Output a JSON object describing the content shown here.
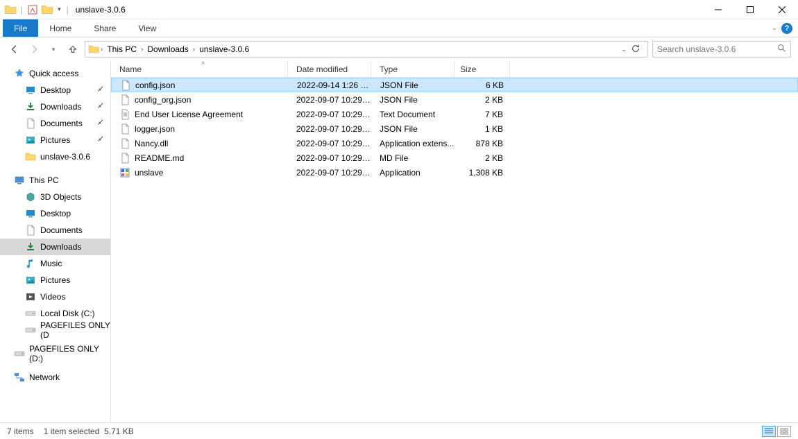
{
  "title": "unslave-3.0.6",
  "ribbon": {
    "file": "File",
    "home": "Home",
    "share": "Share",
    "view": "View"
  },
  "breadcrumbs": [
    "This PC",
    "Downloads",
    "unslave-3.0.6"
  ],
  "search_placeholder": "Search unslave-3.0.6",
  "columns": {
    "name": "Name",
    "date": "Date modified",
    "type": "Type",
    "size": "Size"
  },
  "sidebar": {
    "quick_access": "Quick access",
    "qa_items": [
      {
        "label": "Desktop",
        "icon": "desktop",
        "pinned": true
      },
      {
        "label": "Downloads",
        "icon": "downloads",
        "pinned": true
      },
      {
        "label": "Documents",
        "icon": "documents",
        "pinned": true
      },
      {
        "label": "Pictures",
        "icon": "pictures",
        "pinned": true
      },
      {
        "label": "unslave-3.0.6",
        "icon": "folder",
        "pinned": false
      }
    ],
    "this_pc": "This PC",
    "pc_items": [
      {
        "label": "3D Objects",
        "icon": "3d"
      },
      {
        "label": "Desktop",
        "icon": "desktop"
      },
      {
        "label": "Documents",
        "icon": "documents"
      },
      {
        "label": "Downloads",
        "icon": "downloads",
        "selected": true
      },
      {
        "label": "Music",
        "icon": "music"
      },
      {
        "label": "Pictures",
        "icon": "pictures"
      },
      {
        "label": "Videos",
        "icon": "videos"
      },
      {
        "label": "Local Disk (C:)",
        "icon": "disk"
      },
      {
        "label": "PAGEFILES ONLY (D",
        "icon": "disk"
      }
    ],
    "extra_drive": "PAGEFILES ONLY (D:)",
    "network": "Network"
  },
  "files": [
    {
      "name": "config.json",
      "date": "2022-09-14 1:26 PM",
      "type": "JSON File",
      "size": "6 KB",
      "icon": "file",
      "selected": true
    },
    {
      "name": "config_org.json",
      "date": "2022-09-07 10:29 ...",
      "type": "JSON File",
      "size": "2 KB",
      "icon": "file"
    },
    {
      "name": "End User License Agreement",
      "date": "2022-09-07 10:29 ...",
      "type": "Text Document",
      "size": "7 KB",
      "icon": "text"
    },
    {
      "name": "logger.json",
      "date": "2022-09-07 10:29 ...",
      "type": "JSON File",
      "size": "1 KB",
      "icon": "file"
    },
    {
      "name": "Nancy.dll",
      "date": "2022-09-07 10:29 ...",
      "type": "Application extens...",
      "size": "878 KB",
      "icon": "file"
    },
    {
      "name": "README.md",
      "date": "2022-09-07 10:29 ...",
      "type": "MD File",
      "size": "2 KB",
      "icon": "file"
    },
    {
      "name": "unslave",
      "date": "2022-09-07 10:29 ...",
      "type": "Application",
      "size": "1,308 KB",
      "icon": "app"
    }
  ],
  "status": {
    "count": "7 items",
    "selection": "1 item selected",
    "sel_size": "5.71 KB"
  }
}
